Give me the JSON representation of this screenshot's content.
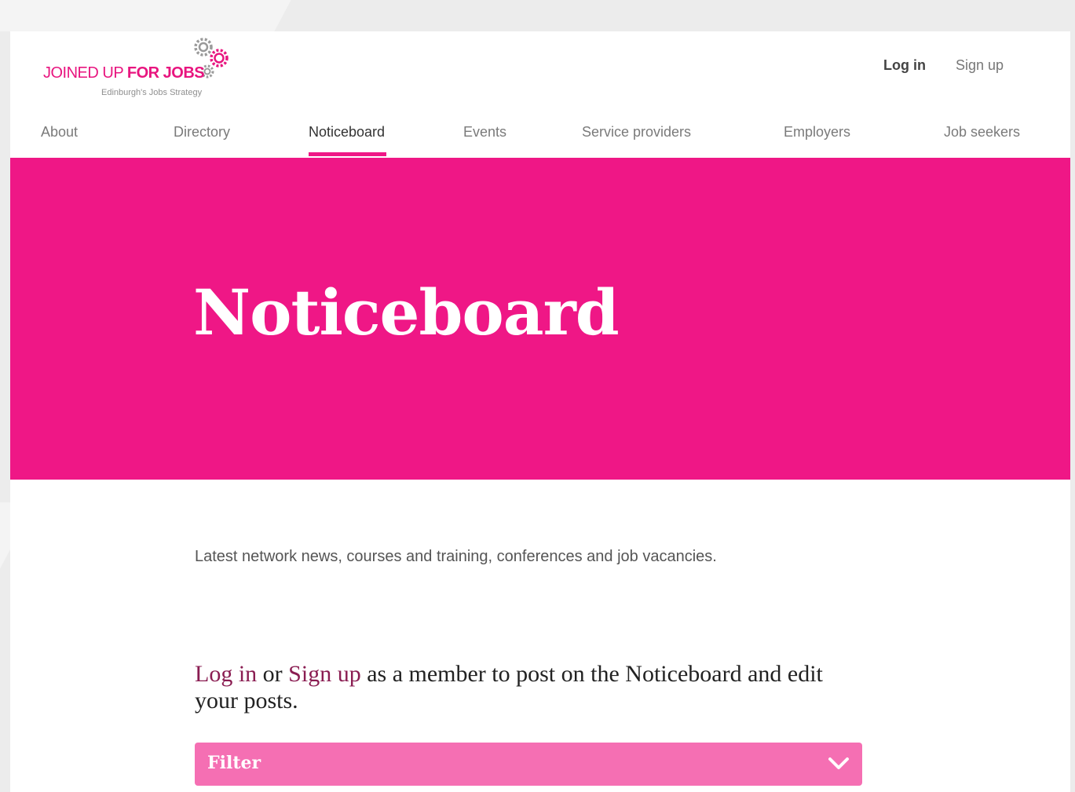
{
  "header": {
    "logo": {
      "name_part1": "JOINED UP ",
      "name_part2": "FOR JOBS",
      "tagline": "Edinburgh's Jobs Strategy"
    },
    "auth": {
      "login_label": "Log in",
      "signup_label": "Sign up"
    },
    "nav": [
      {
        "label": "About"
      },
      {
        "label": "Directory"
      },
      {
        "label": "Noticeboard",
        "active": true
      },
      {
        "label": "Events"
      },
      {
        "label": "Service providers"
      },
      {
        "label": "Employers"
      },
      {
        "label": "Job seekers"
      }
    ]
  },
  "hero": {
    "title": "Noticeboard"
  },
  "main": {
    "intro": "Latest network news, courses and training, conferences and job vacancies.",
    "member_prompt": {
      "login_link": "Log in",
      "or_text": " or ",
      "signup_link": "Sign up",
      "rest": " as a member to post on the Noticeboard and edit your posts."
    },
    "filter": {
      "label": "Filter",
      "icon": "chevron-down-icon"
    }
  },
  "colors": {
    "brand_pink": "#ef1786",
    "filter_pink": "#f56fb3",
    "link_plum": "#8a1d52"
  }
}
